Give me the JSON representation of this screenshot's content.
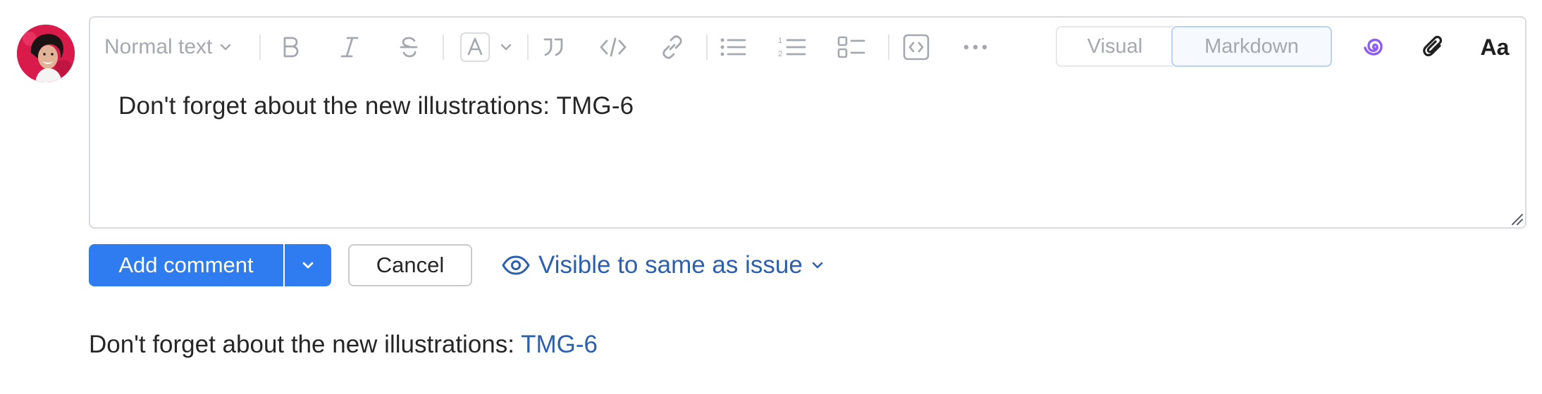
{
  "toolbar": {
    "text_style": "Normal text",
    "icons": [
      "bold-icon",
      "italic-icon",
      "strikethrough-icon",
      "text-color-icon",
      "quote-icon",
      "code-icon",
      "link-icon",
      "bulleted-list-icon",
      "numbered-list-icon",
      "checklist-icon",
      "code-block-icon",
      "more-icon"
    ],
    "mode_visual": "Visual",
    "mode_markdown": "Markdown",
    "mode_selected": "Markdown",
    "right_icons": [
      "ai-assistant-icon",
      "attachment-icon",
      "formatting-icon"
    ],
    "formatting_label": "Aa"
  },
  "editor": {
    "text": "Don't forget about the new illustrations: TMG-6"
  },
  "actions": {
    "add_comment": "Add comment",
    "cancel": "Cancel",
    "visibility": "Visible to same as issue"
  },
  "preview": {
    "text": "Don't forget about the new illustrations: ",
    "link": "TMG-6"
  },
  "colors": {
    "primary": "#2f7bf0",
    "link": "#2c5fae",
    "ai_icon": "#8b5cf6",
    "avatar_bg": "#d81b4a"
  }
}
